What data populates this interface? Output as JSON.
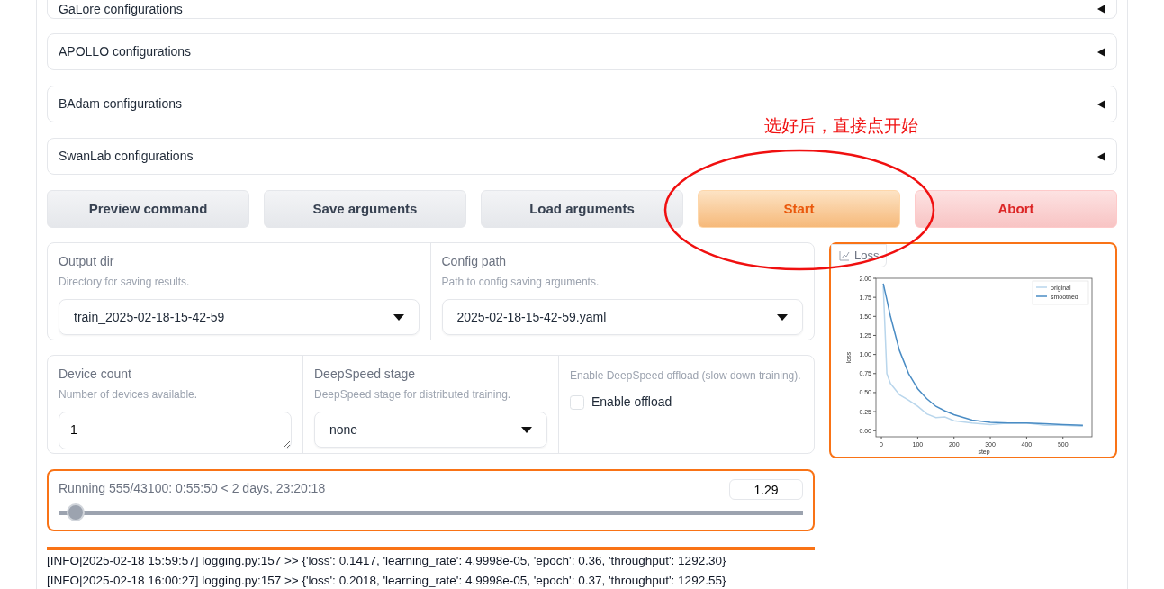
{
  "accordions": [
    {
      "label": "GaLore configurations",
      "expanded": false
    },
    {
      "label": "APOLLO configurations",
      "expanded": false
    },
    {
      "label": "BAdam configurations",
      "expanded": false
    },
    {
      "label": "SwanLab configurations",
      "expanded": false
    }
  ],
  "buttons": [
    {
      "label": "Preview command",
      "kind": "secondary"
    },
    {
      "label": "Save arguments",
      "kind": "secondary"
    },
    {
      "label": "Load arguments",
      "kind": "secondary"
    },
    {
      "label": "Start",
      "kind": "primary"
    },
    {
      "label": "Abort",
      "kind": "stop"
    }
  ],
  "output_dir": {
    "label": "Output dir",
    "info": "Directory for saving results.",
    "value": "train_2025-02-18-15-42-59"
  },
  "config_path": {
    "label": "Config path",
    "info": "Path to config saving arguments.",
    "value": "2025-02-18-15-42-59.yaml"
  },
  "device_count": {
    "label": "Device count",
    "info": "Number of devices available.",
    "value": "1"
  },
  "deepspeed_stage": {
    "label": "DeepSpeed stage",
    "info": "DeepSpeed stage for distributed training.",
    "value": "none"
  },
  "offload": {
    "info": "Enable DeepSpeed offload (slow down training).",
    "label": "Enable offload",
    "checked": false
  },
  "progress": {
    "text": "Running 555/43100: 0:55:50 < 2 days, 23:20:18",
    "level": 0.0129,
    "value": "1.29"
  },
  "log": [
    "[INFO|2025-02-18 15:59:57] logging.py:157 >> {'loss': 0.1417, 'learning_rate': 4.9998e-05, 'epoch': 0.36, 'throughput': 1292.30}",
    "[INFO|2025-02-18 16:00:27] logging.py:157 >> {'loss': 0.2018, 'learning_rate': 4.9998e-05, 'epoch': 0.37, 'throughput': 1292.55}"
  ],
  "loss_panel": {
    "label": "Loss",
    "chart_data": {
      "type": "line",
      "xlabel": "step",
      "ylabel": "loss",
      "x": [
        5,
        15,
        25,
        50,
        75,
        100,
        125,
        150,
        175,
        200,
        250,
        300,
        350,
        400,
        450,
        500,
        555
      ],
      "series": [
        {
          "name": "original",
          "color": "#b9d6ec",
          "values": [
            1.9,
            0.75,
            0.62,
            0.47,
            0.4,
            0.32,
            0.22,
            0.17,
            0.18,
            0.13,
            0.1,
            0.08,
            0.1,
            0.1,
            0.07,
            0.07,
            0.06
          ]
        },
        {
          "name": "smoothed",
          "color": "#4a8cc4",
          "values": [
            1.93,
            1.72,
            1.5,
            1.05,
            0.75,
            0.55,
            0.42,
            0.32,
            0.26,
            0.21,
            0.14,
            0.11,
            0.1,
            0.1,
            0.09,
            0.08,
            0.07
          ]
        }
      ],
      "legend": true,
      "xlim": [
        -15,
        580
      ],
      "ylim": [
        -0.08,
        2.0
      ],
      "xticks": [
        0,
        100,
        200,
        300,
        400,
        500
      ],
      "yticks": [
        {
          "value": 0,
          "label": "0.00"
        },
        {
          "value": 0.25,
          "label": "0.25"
        },
        {
          "value": 0.5,
          "label": "0.50"
        },
        {
          "value": 0.75,
          "label": "0.75"
        },
        {
          "value": 1,
          "label": "1.00"
        },
        {
          "value": 1.25,
          "label": "1.25"
        },
        {
          "value": 1.5,
          "label": "1.50"
        },
        {
          "value": 1.75,
          "label": "1.75"
        },
        {
          "value": 2,
          "label": "2.00"
        }
      ]
    }
  },
  "annotation": {
    "text": "选好后，直接点开始"
  }
}
